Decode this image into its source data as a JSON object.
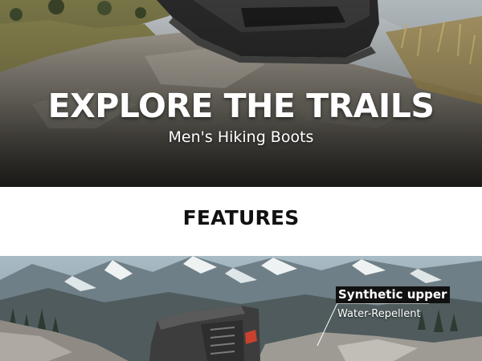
{
  "hero": {
    "title": "EXPLORE THE TRAILS",
    "subtitle": "Men's Hiking Boots"
  },
  "features": {
    "title": "FEATURES"
  },
  "callouts": {
    "upper_label": "Synthetic upper",
    "upper_detail": "Water-Repellent"
  },
  "colors": {
    "hero_overlay": "#000000",
    "band_background": "#ffffff",
    "features_text": "#111111",
    "callout_background": "#111111",
    "callout_text": "#ffffff"
  },
  "icons": {
    "hero_image": "hiking-boot-on-rock-photo",
    "scene_image": "mountain-boot-photo"
  }
}
